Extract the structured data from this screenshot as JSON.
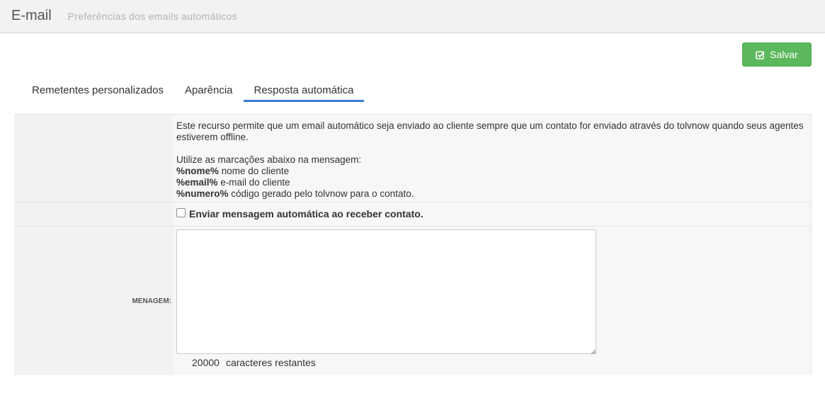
{
  "header": {
    "title": "E-mail",
    "subtitle": "Preferências dos emails automáticos"
  },
  "toolbar": {
    "save_label": "Salvar",
    "save_icon": "check-square-icon"
  },
  "tabs": [
    {
      "label": "Remetentes personalizados",
      "active": false
    },
    {
      "label": "Aparência",
      "active": false
    },
    {
      "label": "Resposta automática",
      "active": true
    }
  ],
  "info": {
    "description": "Este recurso permite que um email automático seja enviado ao cliente sempre que um contato for enviado através do tolvnow quando seus agentes estiverem offline.",
    "markers_intro": "Utilize as marcações abaixo na mensagem:",
    "markers": [
      {
        "tag": "%nome%",
        "desc": "nome do cliente"
      },
      {
        "tag": "%email%",
        "desc": "e-mail do cliente"
      },
      {
        "tag": "%numero%",
        "desc": "código gerado pelo tolvnow para o contato."
      }
    ]
  },
  "auto_reply": {
    "checkbox_label": "Enviar mensagem automática ao receber contato.",
    "checked": false
  },
  "message": {
    "label": "MENAGEM:",
    "value": "",
    "remaining_count": "20000",
    "remaining_label": "caracteres restantes"
  },
  "colors": {
    "save_button": "#5cb85c",
    "tab_active_underline": "#3a7bd5"
  }
}
